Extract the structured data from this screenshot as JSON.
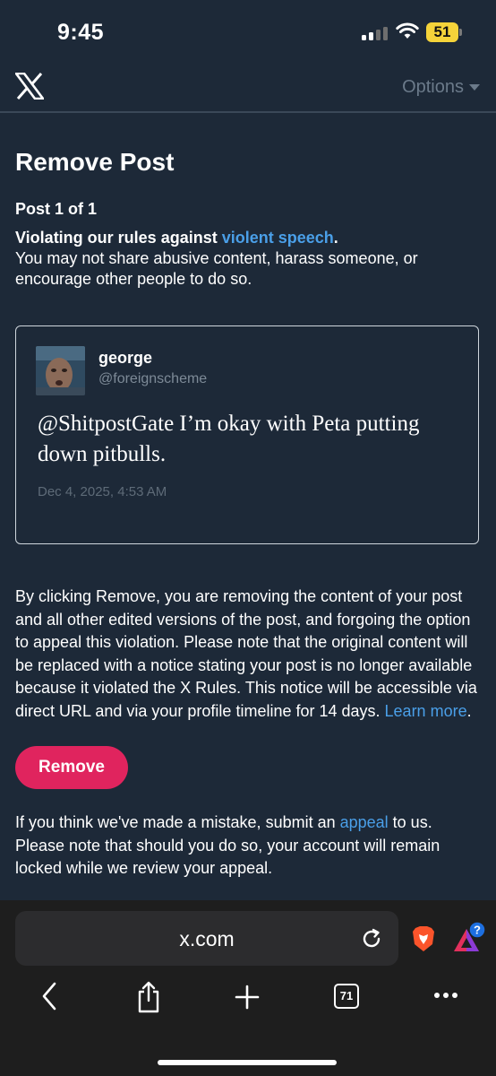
{
  "status_bar": {
    "time": "9:45",
    "battery": "51"
  },
  "header": {
    "options_label": "Options"
  },
  "page": {
    "title": "Remove Post",
    "post_count": "Post 1 of 1",
    "violation_prefix": "Violating our rules against ",
    "violation_link": "violent speech",
    "violation_suffix": ".",
    "violation_desc": "You may not share abusive content, harass someone, or encourage other people to do so."
  },
  "post": {
    "name": "george",
    "handle": "@foreignscheme",
    "text": "@ShitpostGate I’m okay with Peta putting down pitbulls.",
    "date": "Dec 4, 2025, 4:53 AM"
  },
  "notice": {
    "text": "By clicking Remove, you are removing the content of your post and all other edited versions of the post, and forgoing the option to appeal this violation. Please note that the original content will be replaced with a notice stating your post is no longer available because it violated the X Rules. This notice will be accessible via direct URL and via your profile timeline for 14 days. ",
    "learn_more": "Learn more",
    "end": "."
  },
  "remove_button": "Remove",
  "appeal": {
    "prefix": "If you think we've made a mistake, submit an ",
    "link": "appeal",
    "suffix": " to us. Please note that should you do so, your account will remain locked while we review your appeal."
  },
  "browser": {
    "url": "x.com",
    "tab_count": "71",
    "icons": [
      "back-icon",
      "share-icon",
      "new-tab-icon",
      "tabs-icon",
      "more-icon",
      "reload-icon",
      "brave-shields-icon",
      "brave-rewards-icon"
    ]
  },
  "colors": {
    "background": "#1d2938",
    "link": "#4a9fe8",
    "remove": "#e0245e"
  }
}
